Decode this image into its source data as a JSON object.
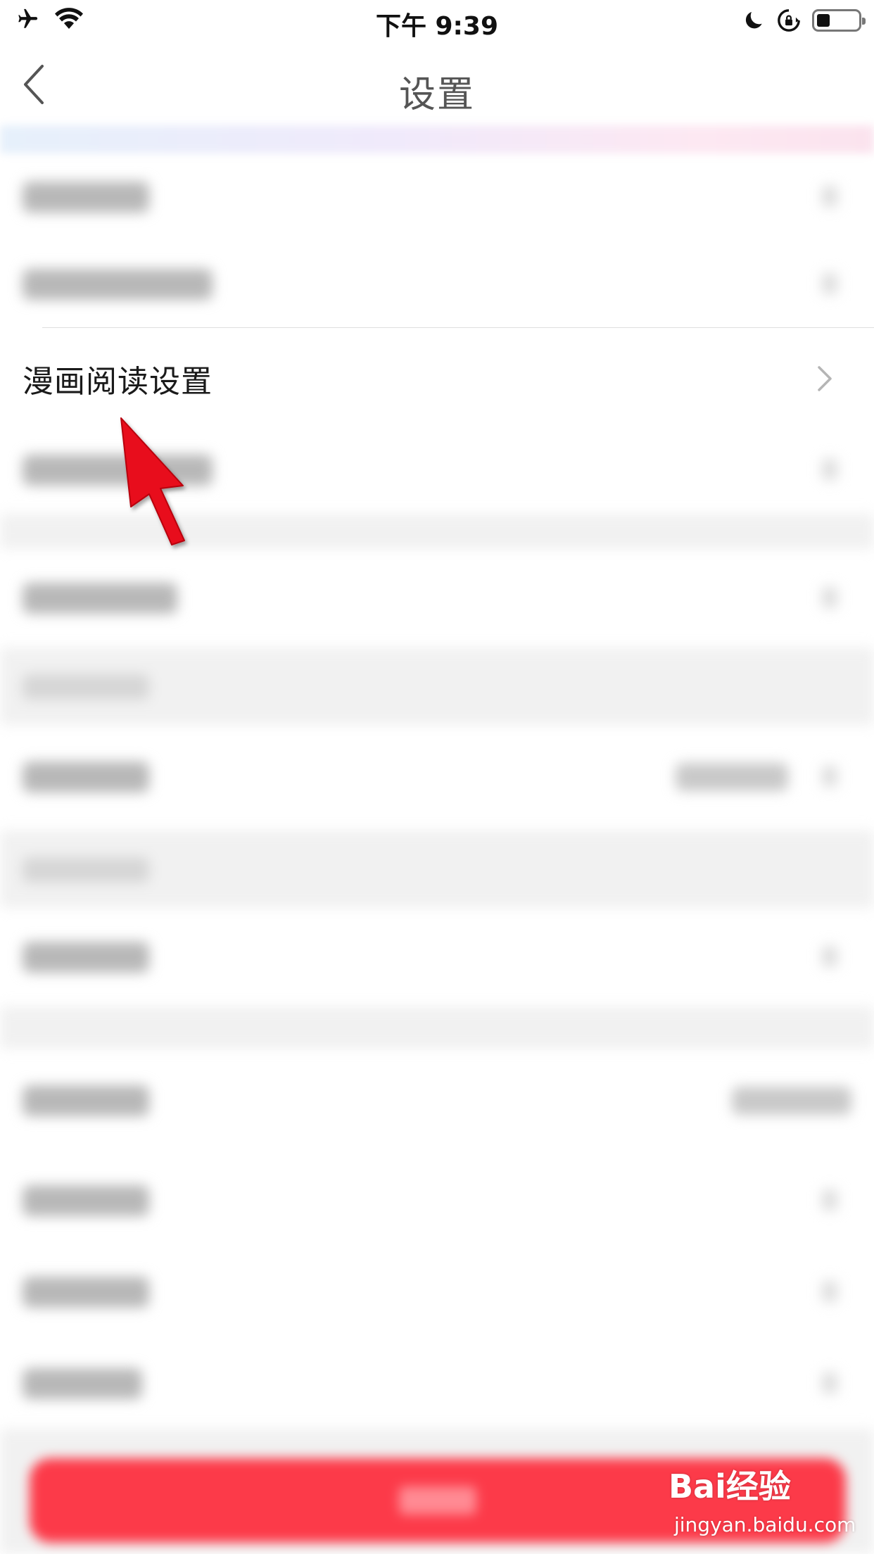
{
  "status_bar": {
    "time": "下午 9:39",
    "icons": [
      "airplane-icon",
      "wifi-icon",
      "moon-icon",
      "rotation-lock-icon",
      "battery-icon"
    ]
  },
  "nav": {
    "title": "设置",
    "back_icon": "chevron-left-icon"
  },
  "settings": {
    "focused_item": {
      "label": "漫画阅读设置",
      "icon": "chevron-right-icon"
    }
  },
  "annotation": {
    "icon": "red-arrow-icon",
    "color": "#e8101c"
  },
  "colors": {
    "accent": "#fc3a49",
    "title": "#555555",
    "divider": "#dedede"
  },
  "watermark": {
    "logo": "Bai经验",
    "url": "jingyan.baidu.com"
  }
}
